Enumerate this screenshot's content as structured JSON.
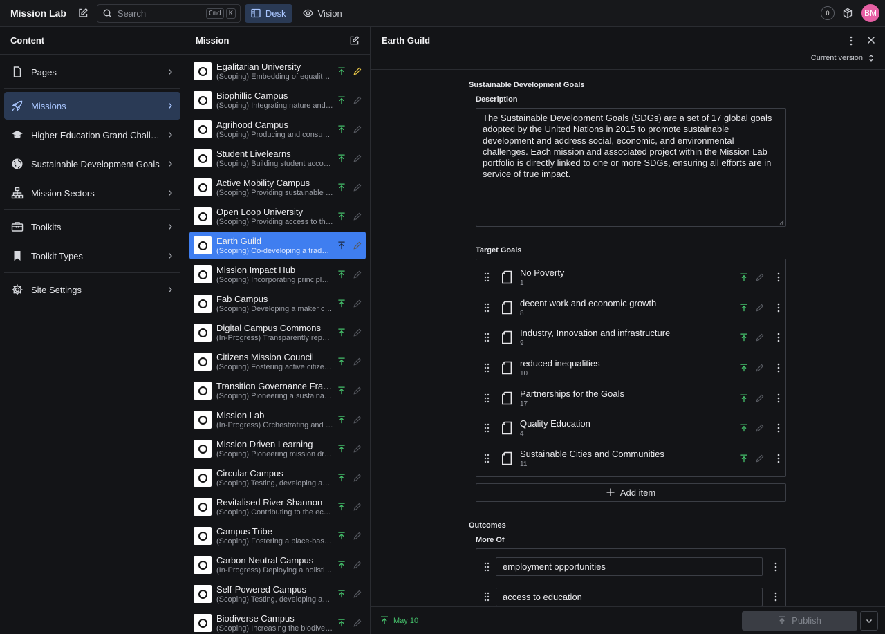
{
  "topbar": {
    "brand": "Mission Lab",
    "search_placeholder": "Search",
    "kbd_cmd": "Cmd",
    "kbd_k": "K",
    "tabs": [
      {
        "label": "Desk",
        "active": true
      },
      {
        "label": "Vision",
        "active": false
      }
    ],
    "notification_count": "0",
    "avatar_initials": "BM"
  },
  "content_pane": {
    "title": "Content",
    "items": [
      {
        "label": "Pages",
        "icon": "document-icon"
      },
      {
        "label": "Missions",
        "icon": "rocket-icon",
        "active": true
      },
      {
        "label": "Higher Education Grand Challen...",
        "icon": "graduation-cap-icon"
      },
      {
        "label": "Sustainable Development Goals",
        "icon": "globe-icon"
      },
      {
        "label": "Mission Sectors",
        "icon": "sitemap-icon"
      },
      {
        "label": "Toolkits",
        "icon": "toolbox-icon"
      },
      {
        "label": "Toolkit Types",
        "icon": "bookmark-icon"
      },
      {
        "label": "Site Settings",
        "icon": "gear-icon"
      }
    ]
  },
  "mission_pane": {
    "title": "Mission",
    "items": [
      {
        "title": "Egalitarian University",
        "subtitle": "(Scoping) Embedding of equality ...",
        "editing": true
      },
      {
        "title": "Biophillic Campus",
        "subtitle": "(Scoping) Integrating nature and n..."
      },
      {
        "title": "Agrihood Campus",
        "subtitle": "(Scoping) Producing and consumi..."
      },
      {
        "title": "Student Livelearns",
        "subtitle": "(Scoping) Building student accom..."
      },
      {
        "title": "Active Mobility Campus",
        "subtitle": "(Scoping) Providing sustainable fo..."
      },
      {
        "title": "Open Loop University",
        "subtitle": "(Scoping) Providing access to the ..."
      },
      {
        "title": "Earth Guild",
        "subtitle": "(Scoping) Co-developing a trade s...",
        "active": true
      },
      {
        "title": "Mission Impact Hub",
        "subtitle": "(Scoping) Incorporating principles ..."
      },
      {
        "title": "Fab Campus",
        "subtitle": "(Scoping) Developing a maker cult..."
      },
      {
        "title": "Digital Campus Commons",
        "subtitle": "(In-Progress) Transparently report..."
      },
      {
        "title": "Citizens Mission Council",
        "subtitle": "(Scoping) Fostering active citizens..."
      },
      {
        "title": "Transition Governance Fram...",
        "subtitle": "(Scoping) Pioneering a sustainabili..."
      },
      {
        "title": "Mission Lab",
        "subtitle": "(In-Progress) Orchestrating and le..."
      },
      {
        "title": "Mission Driven Learning",
        "subtitle": "(Scoping) Pioneering mission drive..."
      },
      {
        "title": "Circular Campus",
        "subtitle": "(Scoping) Testing, developing and ..."
      },
      {
        "title": "Revitalised River Shannon",
        "subtitle": "(Scoping) Contributing to the ecol..."
      },
      {
        "title": "Campus Tribe",
        "subtitle": "(Scoping) Fostering a place-based..."
      },
      {
        "title": "Carbon Neutral Campus",
        "subtitle": "(In-Progress) Deploying a holistic ..."
      },
      {
        "title": "Self-Powered Campus",
        "subtitle": "(Scoping) Testing, developing and ..."
      },
      {
        "title": "Biodiverse Campus",
        "subtitle": "(Scoping) Increasing the biodiversi..."
      }
    ]
  },
  "document": {
    "title": "Earth Guild",
    "version": "Current version",
    "sdg_section": "Sustainable Development Goals",
    "description_label": "Description",
    "description": "The Sustainable Development Goals (SDGs) are a set of 17 global goals adopted by the United Nations in 2015 to promote sustainable development and address social, economic, and environmental challenges. Each mission and associated project within the Mission Lab portfolio is directly linked to one or more SDGs, ensuring all efforts are in service of true impact.",
    "target_goals_label": "Target Goals",
    "target_goals": [
      {
        "title": "No Poverty",
        "number": "1"
      },
      {
        "title": "decent work and economic growth",
        "number": "8"
      },
      {
        "title": "Industry, Innovation and infrastructure",
        "number": "9"
      },
      {
        "title": "reduced inequalities",
        "number": "10"
      },
      {
        "title": "Partnerships for the Goals",
        "number": "17"
      },
      {
        "title": "Quality Education",
        "number": "4"
      },
      {
        "title": "Sustainable Cities and Communities",
        "number": "11"
      }
    ],
    "add_item_label": "Add item",
    "outcomes_label": "Outcomes",
    "more_of_label": "More Of",
    "more_of": [
      "employment opportunities",
      "access to education"
    ]
  },
  "footer": {
    "date": "May 10",
    "publish_label": "Publish"
  },
  "colors": {
    "accent": "#3f7ef0",
    "published": "#45c16b",
    "avatar": "#e65fa3",
    "editing": "#e8c547"
  }
}
